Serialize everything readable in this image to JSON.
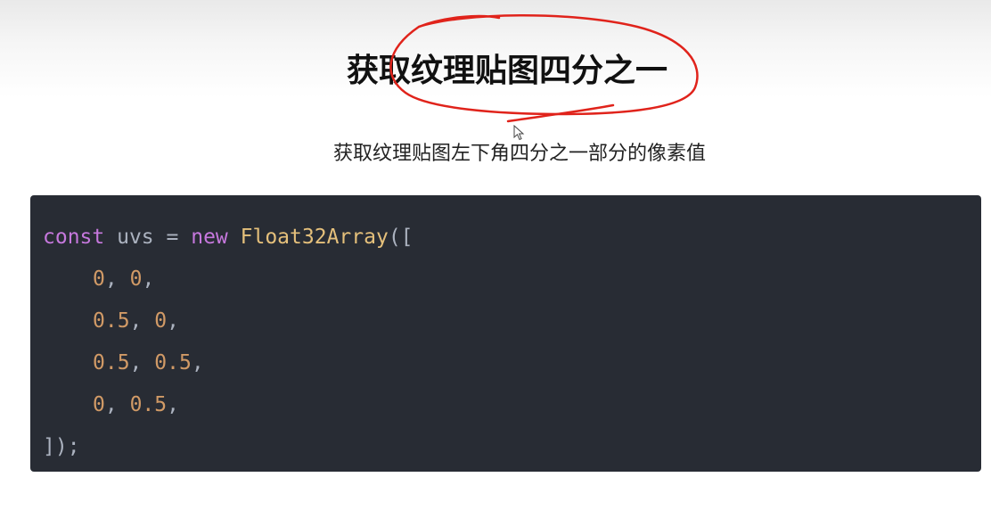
{
  "page": {
    "title": "获取纹理贴图四分之一",
    "subtitle": "获取纹理贴图左下角四分之一部分的像素值"
  },
  "code": {
    "line1": {
      "keyword1": "const",
      "variable": "uvs",
      "operator": "=",
      "keyword2": "new",
      "constructor": "Float32Array",
      "open": "(["
    },
    "rows": [
      {
        "a": "0",
        "b": "0"
      },
      {
        "a": "0.5",
        "b": "0"
      },
      {
        "a": "0.5",
        "b": "0.5"
      },
      {
        "a": "0",
        "b": "0.5"
      }
    ],
    "separator": ",",
    "closing": "]);"
  },
  "colors": {
    "code_background": "#282c34",
    "keyword": "#c678dd",
    "function": "#e5c07b",
    "number": "#d19a66",
    "plain": "#abb2bf",
    "annotation": "#e0231b"
  },
  "icons": {
    "cursor": "mouse-pointer-icon",
    "annotation": "red-ink-circle-annotation"
  }
}
